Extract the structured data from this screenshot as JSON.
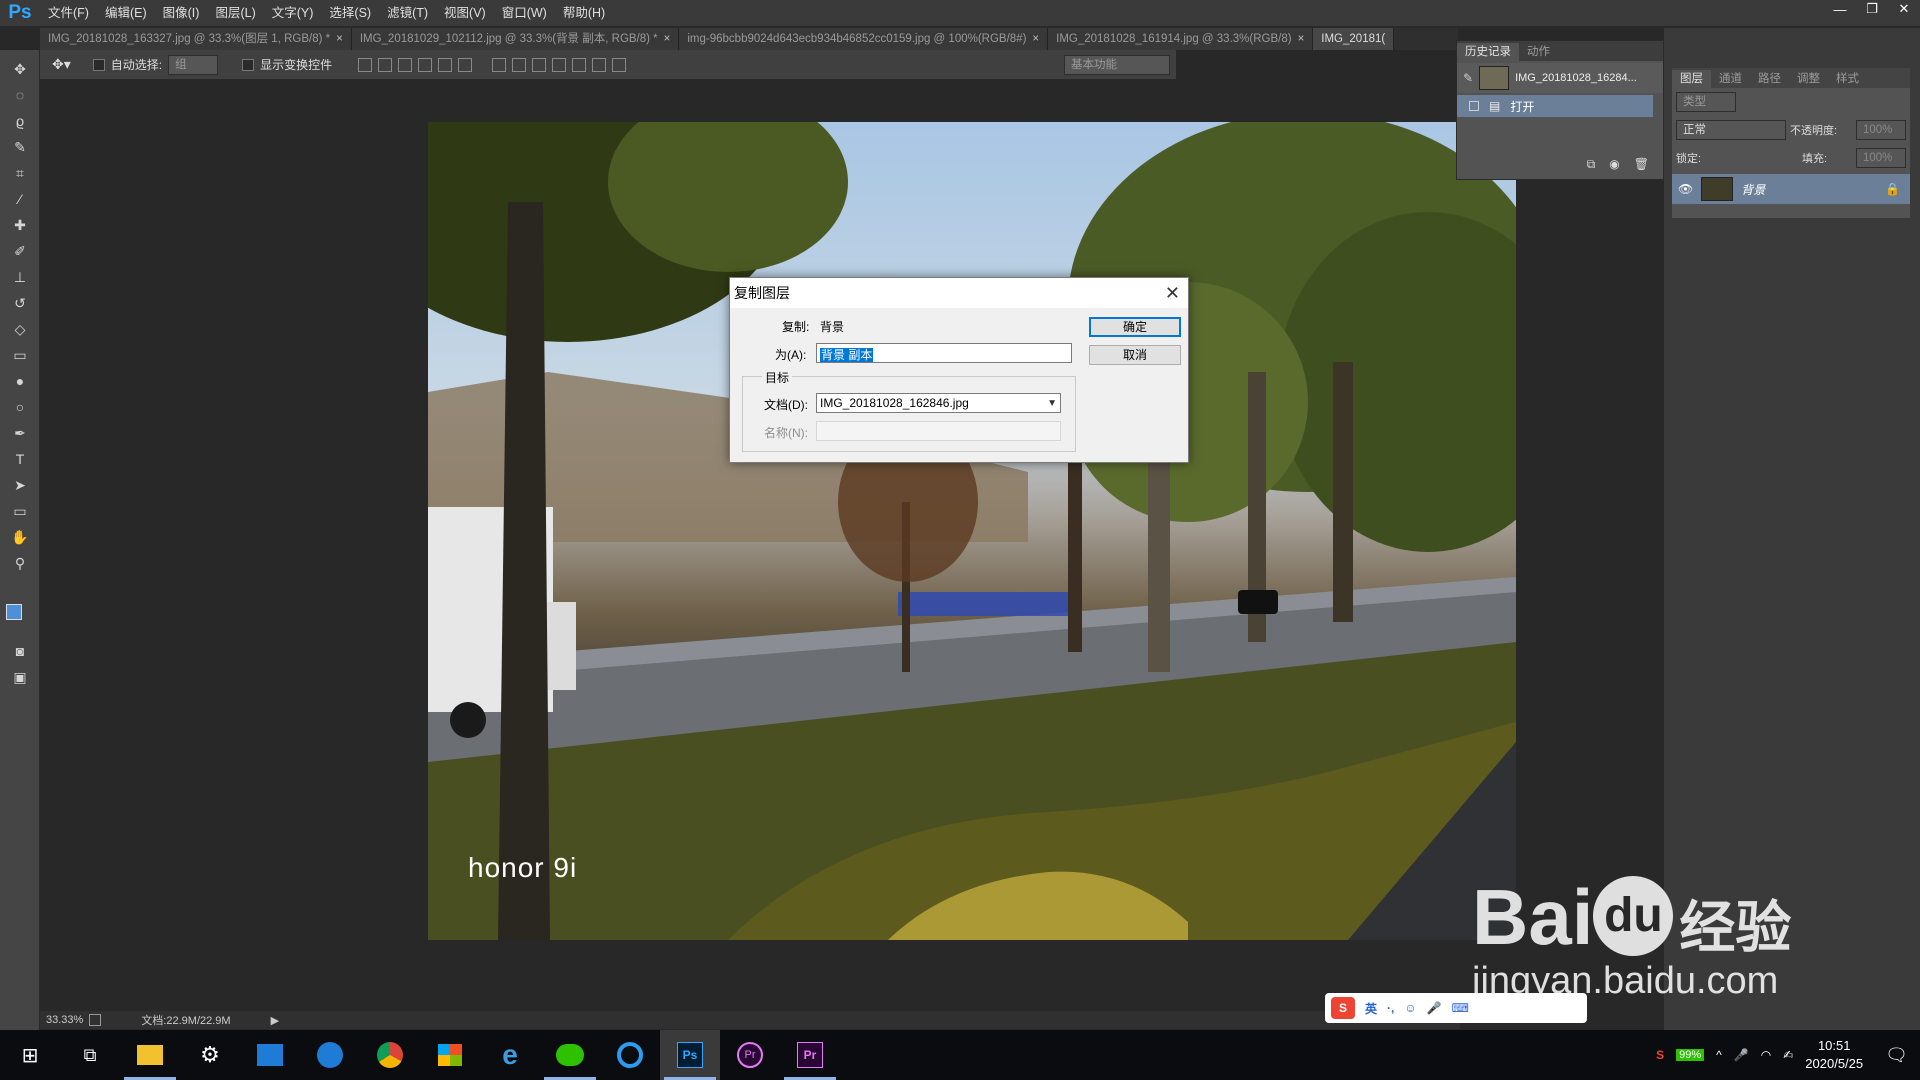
{
  "app": {
    "logo": "Ps",
    "menu": [
      "文件(F)",
      "编辑(E)",
      "图像(I)",
      "图层(L)",
      "文字(Y)",
      "选择(S)",
      "滤镜(T)",
      "视图(V)",
      "窗口(W)",
      "帮助(H)"
    ]
  },
  "window_controls": {
    "min": "—",
    "restore": "❐",
    "close": "✕"
  },
  "tabs": [
    {
      "label": "IMG_20181028_163327.jpg @ 33.3%(图层 1, RGB/8) *"
    },
    {
      "label": "IMG_20181029_102112.jpg @ 33.3%(背景 副本, RGB/8) *"
    },
    {
      "label": "img-96bcbb9024d643ecb934b46852cc0159.jpg @ 100%(RGB/8#)"
    },
    {
      "label": "IMG_20181028_161914.jpg @ 33.3%(RGB/8)"
    },
    {
      "label": "IMG_20181("
    }
  ],
  "options": {
    "auto_select_label": "自动选择:",
    "auto_select_value": "组",
    "show_transform_label": "显示变换控件",
    "workspace": "基本功能"
  },
  "status": {
    "zoom": "33.33%",
    "doc": "文档:22.9M/22.9M"
  },
  "dialog": {
    "title": "复制图层",
    "copy_label": "复制:",
    "copy_value": "背景",
    "as_label": "为(A):",
    "as_value": "背景 副本",
    "target_label": "目标",
    "doc_label": "文档(D):",
    "doc_value": "IMG_20181028_162846.jpg",
    "name_label": "名称(N):",
    "ok": "确定",
    "cancel": "取消"
  },
  "history": {
    "tabs": [
      "历史记录",
      "动作"
    ],
    "snapshot": "IMG_20181028_16284...",
    "step": "打开"
  },
  "layers": {
    "tabs": [
      "图层",
      "通道",
      "路径",
      "调整",
      "样式"
    ],
    "kind": "类型",
    "blend": "正常",
    "opacity_label": "不透明度:",
    "opacity": "100%",
    "lock_label": "锁定:",
    "fill_label": "填充:",
    "fill": "100%",
    "layer_name": "背景"
  },
  "photo": {
    "watermark": "honor 9i"
  },
  "baidu": {
    "text": "Bai",
    "du": "du",
    "jingyan": "经验",
    "url": "jingyan.baidu.com"
  },
  "ime": {
    "lang": "英"
  },
  "taskbar": {
    "battery": "99%",
    "time": "10:51",
    "date": "2020/5/25"
  }
}
